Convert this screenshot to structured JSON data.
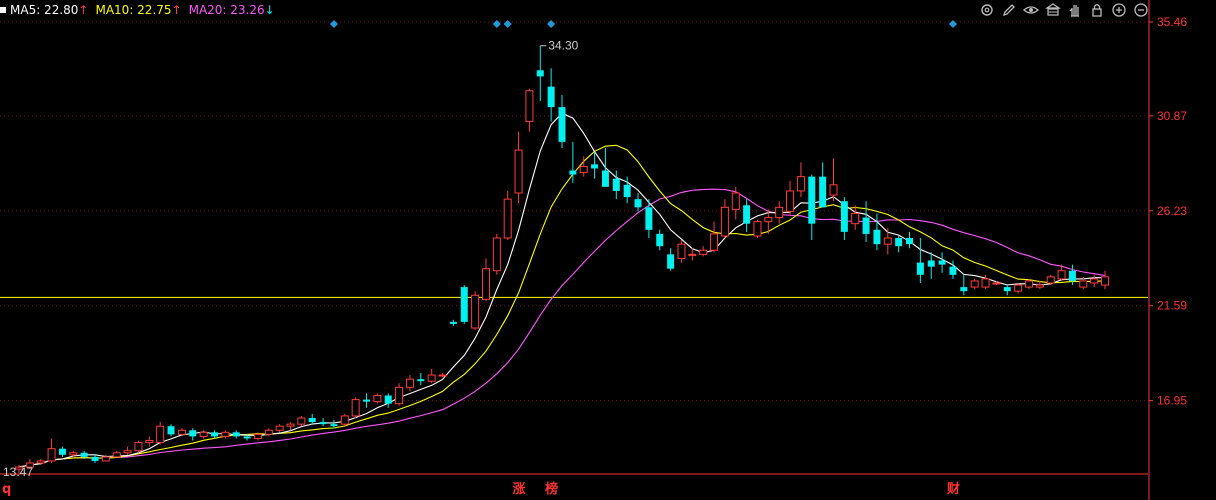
{
  "legend": [
    {
      "label": "MA5: 22.80",
      "arrow": "↑",
      "color": "#ffffff"
    },
    {
      "label": "MA10: 22.75",
      "arrow": "↑",
      "color": "#ffff00"
    },
    {
      "label": "MA20: 23.26",
      "arrow": "↓",
      "color": "#ff55ff"
    }
  ],
  "toolbar_icons": [
    "settings-icon",
    "pen-icon",
    "eye-icon",
    "bank-icon",
    "hand-icon",
    "lock-icon",
    "zoom-in-icon",
    "zoom-out-icon"
  ],
  "colors": {
    "up": "#ff3b3b",
    "down": "#00f0f0",
    "ma5": "#ffffff",
    "ma10": "#ffff00",
    "ma20": "#ff55ff",
    "axis": "#ff3232",
    "grid": "#7a1414",
    "hline": "#ffff00",
    "marker": "#1e9bd8"
  },
  "chart_data": {
    "type": "candlestick",
    "y_ticks": [
      "35.46",
      "30.87",
      "26.23",
      "21.59",
      "16.95"
    ],
    "y_range": [
      12.4,
      35.46
    ],
    "high_label": "34.30",
    "low_label": "13.47",
    "horizontal_line": 22.0,
    "event_labels": [
      {
        "text": "q",
        "index": 0
      },
      {
        "text": "涨",
        "index": 46
      },
      {
        "text": "榜",
        "index": 49
      },
      {
        "text": "财",
        "index": 86
      }
    ],
    "top_markers": [
      29,
      44,
      45,
      49,
      86
    ],
    "candles": [
      [
        13.6,
        13.8,
        13.4,
        13.7
      ],
      [
        13.7,
        14.1,
        13.6,
        13.9
      ],
      [
        13.9,
        14.1,
        13.8,
        14.0
      ],
      [
        14.0,
        15.1,
        13.9,
        14.6
      ],
      [
        14.6,
        14.7,
        14.2,
        14.3
      ],
      [
        14.3,
        14.5,
        14.2,
        14.4
      ],
      [
        14.4,
        14.5,
        14.1,
        14.2
      ],
      [
        14.2,
        14.3,
        13.9,
        14.0
      ],
      [
        14.0,
        14.3,
        14.0,
        14.2
      ],
      [
        14.2,
        14.5,
        14.2,
        14.4
      ],
      [
        14.4,
        14.7,
        14.3,
        14.5
      ],
      [
        14.5,
        15.0,
        14.4,
        14.9
      ],
      [
        14.9,
        15.2,
        14.7,
        15.0
      ],
      [
        14.9,
        15.9,
        14.8,
        15.7
      ],
      [
        15.7,
        15.8,
        15.2,
        15.3
      ],
      [
        15.3,
        15.6,
        15.2,
        15.5
      ],
      [
        15.5,
        15.6,
        15.0,
        15.2
      ],
      [
        15.2,
        15.5,
        15.1,
        15.4
      ],
      [
        15.4,
        15.5,
        15.1,
        15.2
      ],
      [
        15.2,
        15.5,
        15.1,
        15.4
      ],
      [
        15.4,
        15.5,
        15.1,
        15.2
      ],
      [
        15.2,
        15.3,
        15.0,
        15.1
      ],
      [
        15.1,
        15.4,
        15.0,
        15.3
      ],
      [
        15.3,
        15.6,
        15.2,
        15.5
      ],
      [
        15.5,
        15.8,
        15.4,
        15.7
      ],
      [
        15.7,
        15.9,
        15.5,
        15.8
      ],
      [
        15.8,
        16.2,
        15.7,
        16.1
      ],
      [
        16.1,
        16.3,
        15.8,
        15.9
      ],
      [
        15.9,
        16.1,
        15.7,
        15.8
      ],
      [
        15.8,
        16.0,
        15.6,
        15.7
      ],
      [
        15.8,
        16.3,
        15.7,
        16.2
      ],
      [
        16.2,
        17.1,
        16.1,
        17.0
      ],
      [
        17.0,
        17.3,
        16.6,
        16.9
      ],
      [
        16.9,
        17.3,
        16.8,
        17.2
      ],
      [
        17.2,
        17.3,
        16.6,
        16.8
      ],
      [
        16.8,
        17.8,
        16.7,
        17.6
      ],
      [
        17.6,
        18.2,
        17.4,
        18.0
      ],
      [
        18.0,
        18.3,
        17.7,
        17.9
      ],
      [
        17.9,
        18.5,
        17.8,
        18.2
      ],
      [
        18.2,
        18.3,
        18.1,
        18.2
      ],
      [
        20.8,
        20.9,
        20.6,
        20.7
      ],
      [
        22.5,
        22.6,
        20.7,
        20.8
      ],
      [
        20.5,
        22.3,
        20.4,
        22.1
      ],
      [
        21.9,
        23.9,
        21.8,
        23.4
      ],
      [
        23.3,
        25.1,
        23.1,
        24.9
      ],
      [
        24.9,
        27.2,
        24.8,
        26.8
      ],
      [
        27.1,
        30.1,
        26.6,
        29.2
      ],
      [
        30.6,
        32.2,
        30.1,
        32.1
      ],
      [
        33.1,
        34.3,
        31.6,
        32.8
      ],
      [
        32.3,
        33.2,
        30.6,
        31.3
      ],
      [
        31.3,
        31.9,
        29.3,
        29.6
      ],
      [
        28.2,
        29.6,
        27.6,
        28.0
      ],
      [
        28.1,
        28.9,
        27.9,
        28.4
      ],
      [
        28.5,
        29.1,
        27.8,
        28.3
      ],
      [
        28.2,
        29.3,
        27.8,
        27.4
      ],
      [
        27.8,
        28.2,
        26.8,
        27.2
      ],
      [
        27.5,
        27.9,
        26.6,
        26.9
      ],
      [
        26.8,
        27.1,
        26.2,
        26.4
      ],
      [
        26.4,
        26.8,
        24.9,
        25.3
      ],
      [
        25.1,
        25.3,
        24.3,
        24.5
      ],
      [
        24.1,
        24.4,
        23.3,
        23.4
      ],
      [
        23.9,
        24.8,
        23.7,
        24.6
      ],
      [
        24.1,
        24.4,
        23.8,
        24.1
      ],
      [
        24.1,
        24.5,
        24.0,
        24.3
      ],
      [
        24.3,
        25.7,
        24.2,
        25.1
      ],
      [
        25.0,
        26.8,
        24.9,
        26.4
      ],
      [
        26.3,
        27.4,
        25.8,
        27.1
      ],
      [
        26.5,
        26.8,
        25.2,
        25.6
      ],
      [
        25.0,
        25.8,
        24.9,
        25.7
      ],
      [
        25.7,
        26.3,
        25.1,
        25.9
      ],
      [
        25.9,
        26.7,
        25.6,
        26.4
      ],
      [
        26.2,
        27.7,
        26.0,
        27.2
      ],
      [
        27.2,
        28.6,
        26.9,
        27.9
      ],
      [
        27.9,
        28.0,
        24.8,
        25.6
      ],
      [
        27.9,
        28.6,
        26.8,
        26.4
      ],
      [
        27.0,
        28.8,
        26.7,
        27.5
      ],
      [
        26.7,
        26.9,
        24.8,
        25.2
      ],
      [
        25.6,
        26.5,
        25.3,
        26.1
      ],
      [
        25.9,
        26.7,
        24.7,
        25.1
      ],
      [
        25.3,
        26.1,
        24.3,
        24.6
      ],
      [
        24.6,
        25.4,
        24.1,
        24.9
      ],
      [
        24.9,
        25.0,
        24.2,
        24.5
      ],
      [
        24.9,
        25.2,
        24.4,
        24.6
      ],
      [
        23.7,
        24.9,
        22.7,
        23.1
      ],
      [
        23.8,
        24.2,
        22.9,
        23.5
      ],
      [
        23.8,
        24.2,
        23.2,
        23.6
      ],
      [
        23.5,
        23.8,
        22.9,
        23.1
      ],
      [
        22.5,
        23.1,
        22.1,
        22.3
      ],
      [
        22.5,
        22.9,
        22.4,
        22.8
      ],
      [
        22.5,
        23.1,
        22.4,
        22.9
      ],
      [
        22.7,
        22.8,
        22.6,
        22.7
      ],
      [
        22.5,
        22.6,
        22.1,
        22.3
      ],
      [
        22.3,
        22.7,
        22.2,
        22.6
      ],
      [
        22.5,
        22.9,
        22.4,
        22.8
      ],
      [
        22.5,
        22.8,
        22.4,
        22.6
      ],
      [
        22.7,
        23.1,
        22.6,
        23.0
      ],
      [
        22.9,
        23.6,
        22.8,
        23.3
      ],
      [
        23.3,
        23.6,
        22.6,
        22.8
      ],
      [
        22.5,
        23.0,
        22.4,
        22.8
      ],
      [
        22.7,
        23.1,
        22.5,
        22.9
      ],
      [
        22.6,
        23.3,
        22.4,
        23.0
      ]
    ]
  }
}
